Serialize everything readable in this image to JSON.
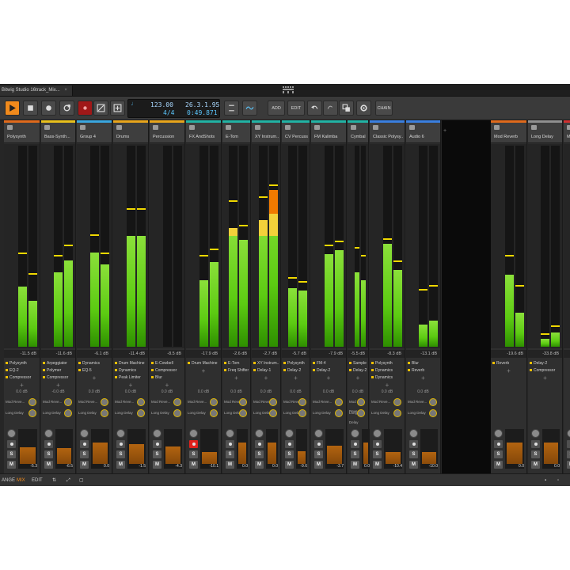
{
  "window": {
    "title": "Bitwig Studio 16track_Mix...",
    "tab_close": "×"
  },
  "toolbar": {
    "tempo": "123.00",
    "signature": "4/4",
    "position": "26.3.1.95",
    "time": "0:49.871",
    "add_label": "ADD",
    "edit_label": "EDIT",
    "chain_label": "CHAIN"
  },
  "tracks": [
    {
      "name": "Polysynth",
      "color": "#e06a1c",
      "db": "-11.5 dB",
      "meters": [
        0.3,
        0.23
      ],
      "peaks": [
        0.46,
        0.36
      ],
      "devices": [
        "Polysynth",
        "EQ-2",
        "Compressor"
      ],
      "send": "0.0 dB",
      "fader": "-5.3",
      "fader_level": 0.62
    },
    {
      "name": "Bass-Synth...",
      "color": "#e8c01c",
      "db": "-11.6 dB",
      "meters": [
        0.37,
        0.43
      ],
      "peaks": [
        0.45,
        0.5
      ],
      "devices": [
        "Arpeggiator",
        "Polymer",
        "Compressor"
      ],
      "send": "-0.0 dB",
      "fader": "-6.5",
      "fader_level": 0.58
    },
    {
      "name": "Group 4",
      "color": "#3aa7e0",
      "db": "-6.1 dB",
      "meters": [
        0.47,
        0.41
      ],
      "peaks": [
        0.55,
        0.46
      ],
      "devices": [
        "Dynamics",
        "EQ-5"
      ],
      "send": "0.0 dB",
      "fader": "0.0",
      "fader_level": 0.75
    },
    {
      "name": "Drums",
      "color": "#e8a51c",
      "db": "-11.4 dB",
      "meters": [
        0.55,
        0.55
      ],
      "peaks": [
        0.68,
        0.68
      ],
      "devices": [
        "Drum Machine",
        "Dynamics",
        "Peak Limiter"
      ],
      "send": "0.0 dB",
      "fader": "-1.5",
      "fader_level": 0.7
    },
    {
      "name": "Percussion",
      "color": "#e8a51c",
      "db": "-8.5 dB",
      "meters": [
        0.0,
        0.0
      ],
      "peaks": [
        0.0,
        0.0
      ],
      "devices": [
        "E-Cowbell",
        "Compressor",
        "Blur"
      ],
      "send": "0.0 dB",
      "fader": "-4.3",
      "fader_level": 0.64
    },
    {
      "name": "FX AndShots",
      "color": "#22b3a4",
      "db": "-17.9 dB",
      "meters": [
        0.33,
        0.42
      ],
      "peaks": [
        0.45,
        0.48
      ],
      "devices": [
        "Drum Machine"
      ],
      "send": "0.0 dB",
      "fader": "-10.1",
      "fader_level": 0.48
    },
    {
      "name": "E-Tom",
      "color": "#22b3a4",
      "db": "-2.6 dB",
      "meters": [
        0.59,
        0.53
      ],
      "peaks": [
        0.72,
        0.6
      ],
      "devices": [
        "E-Tom",
        "Freq Shifter"
      ],
      "send": "0.0 dB",
      "fader": "0.0",
      "fader_level": 0.75
    },
    {
      "name": "XY Instrum...",
      "color": "#22b3a4",
      "db": "-2.7 dB",
      "meters": [
        0.63,
        0.78
      ],
      "peaks": [
        0.74,
        0.8
      ],
      "devices": [
        "XY Instrum...",
        "Delay-1"
      ],
      "send": "0.0 dB",
      "fader": "0.0",
      "fader_level": 0.75
    },
    {
      "name": "CV Percuss...",
      "color": "#22b3a4",
      "db": "-5.7 dB",
      "meters": [
        0.29,
        0.28
      ],
      "peaks": [
        0.34,
        0.32
      ],
      "devices": [
        "Polysynth",
        "Delay-2"
      ],
      "send": "0.0 dB",
      "fader": "-9.6",
      "fader_level": 0.5
    },
    {
      "name": "FM Kalimba",
      "color": "#22b3a4",
      "db": "-7.9 dB",
      "meters": [
        0.46,
        0.48
      ],
      "peaks": [
        0.5,
        0.52
      ],
      "devices": [
        "FM-4",
        "Delay-2"
      ],
      "send": "0.0 dB",
      "fader": "-3.7",
      "fader_level": 0.66
    },
    {
      "name": "Cymbal Cra...",
      "color": "#22b3a4",
      "db": "-5.5 dB",
      "meters": [
        0.37,
        0.33
      ],
      "peaks": [
        0.49,
        0.45
      ],
      "devices": [
        "Sampler",
        "Delay-2"
      ],
      "send": "0.0 dB",
      "fader": "0.0",
      "fader_level": 0.75
    },
    {
      "name": "Classic Polysy...",
      "color": "#3a7fe0",
      "db": "-8.3 dB",
      "meters": [
        0.51,
        0.38
      ],
      "peaks": [
        0.53,
        0.42
      ],
      "devices": [
        "Polysynth",
        "Dynamics",
        "Dynamics"
      ],
      "send": "0.0 dB",
      "fader": "-10.4",
      "fader_level": 0.48
    },
    {
      "name": "Audio 6",
      "color": "#3a7fe0",
      "db": "-13.1 dB",
      "meters": [
        0.11,
        0.13
      ],
      "peaks": [
        0.28,
        0.3
      ],
      "devices": [
        "Blur",
        "Reverb"
      ],
      "send": "0.0 dB",
      "fader": "-10.0",
      "fader_level": 0.48
    },
    {
      "name": "Mod Reverb",
      "color": "#e06a1c",
      "db": "-19.6 dB",
      "meters": [
        0.36,
        0.17
      ],
      "peaks": [
        0.45,
        0.3
      ],
      "devices": [
        "Reverb"
      ],
      "send": "",
      "fader": "0.0",
      "fader_level": 0.75
    },
    {
      "name": "Long Delay",
      "color": "#909090",
      "db": "-33.8 dB",
      "meters": [
        0.04,
        0.07
      ],
      "peaks": [
        0.06,
        0.1
      ],
      "devices": [
        "Delay-2",
        "Compressor"
      ],
      "send": "",
      "fader": "0.0",
      "fader_level": 0.75
    },
    {
      "name": "M",
      "color": "#d03030",
      "db": "",
      "meters": [
        0.0,
        0.0
      ],
      "peaks": [
        0.0,
        0.0
      ],
      "devices": [],
      "send": "",
      "fader": "",
      "fader_level": 0.75
    }
  ],
  "send_labels": {
    "send1": "Mod Reve...",
    "send2": "Long Delay"
  },
  "buttons": {
    "solo": "S",
    "mute": "M"
  },
  "bottombar": {
    "arrange": "ANGE",
    "mix": "MIX",
    "edit": "EDIT"
  }
}
